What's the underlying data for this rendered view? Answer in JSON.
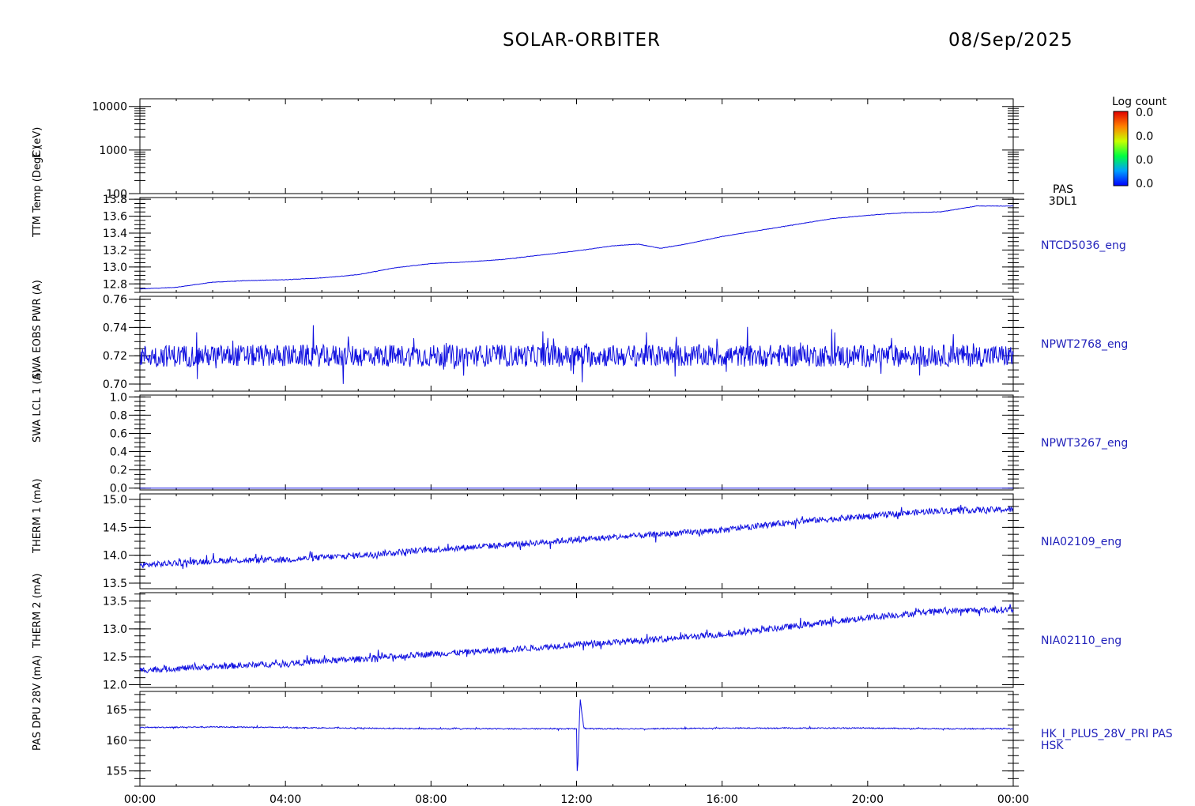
{
  "header": {
    "title": "SOLAR-ORBITER",
    "date": "08/Sep/2025"
  },
  "colors": {
    "trace": "#1010e0",
    "axis": "#000000",
    "label": "#2222bb"
  },
  "colorbar": {
    "title": "Log count",
    "ticks": [
      "0.0",
      "0.0",
      "0.0",
      "0.0"
    ]
  },
  "x_ticks": [
    "00:00",
    "04:00",
    "08:00",
    "12:00",
    "16:00",
    "20:00",
    "00:00"
  ],
  "chart_data": [
    {
      "type": "heatmap",
      "name": "PAS 3DL1",
      "right_label": [
        "PAS",
        "3DL1"
      ],
      "ylabel": "E (eV)",
      "yscale": "log",
      "ylim": [
        100,
        15000
      ],
      "y_ticks": [
        100,
        1000,
        10000
      ],
      "y_tick_labels": [
        "100",
        "1000",
        "10000"
      ],
      "values": []
    },
    {
      "type": "line",
      "name": "NTCD5036_eng",
      "right_label": [
        "NTCD5036_eng"
      ],
      "ylabel": "TTM Temp (DegC)",
      "ylim": [
        12.7,
        13.82
      ],
      "y_ticks": [
        12.8,
        13.0,
        13.2,
        13.4,
        13.6,
        13.8
      ],
      "y_tick_labels": [
        "12.8",
        "13.0",
        "13.2",
        "13.4",
        "13.6",
        "13.8"
      ],
      "noise": 0.004,
      "x": [
        0,
        1,
        2,
        3,
        4,
        5,
        6,
        7,
        8,
        9,
        10,
        11,
        12,
        13,
        13.7,
        14.3,
        15,
        16,
        17,
        18,
        19,
        20,
        21,
        22,
        23,
        24
      ],
      "y": [
        12.74,
        12.76,
        12.82,
        12.84,
        12.85,
        12.87,
        12.91,
        12.99,
        13.04,
        13.06,
        13.09,
        13.14,
        13.19,
        13.25,
        13.27,
        13.22,
        13.27,
        13.36,
        13.43,
        13.5,
        13.57,
        13.61,
        13.64,
        13.65,
        13.72,
        13.72
      ]
    },
    {
      "type": "line",
      "name": "NPWT2768_eng",
      "right_label": [
        "NPWT2768_eng"
      ],
      "ylabel": "SWA EOBS PWR (A)",
      "ylim": [
        0.695,
        0.762
      ],
      "y_ticks": [
        0.7,
        0.72,
        0.74,
        0.76
      ],
      "y_tick_labels": [
        "0.70",
        "0.72",
        "0.74",
        "0.76"
      ],
      "noise": 0.013,
      "x": [
        0,
        12,
        24
      ],
      "y": [
        0.72,
        0.72,
        0.72
      ]
    },
    {
      "type": "line",
      "name": "NPWT3267_eng",
      "right_label": [
        "NPWT3267_eng"
      ],
      "ylabel": "SWA LCL 1 (A)",
      "ylim": [
        -0.02,
        1.02
      ],
      "y_ticks": [
        0.0,
        0.2,
        0.4,
        0.6,
        0.8,
        1.0
      ],
      "y_tick_labels": [
        "0.0",
        "0.2",
        "0.4",
        "0.6",
        "0.8",
        "1.0"
      ],
      "noise": 0.0,
      "x": [
        0,
        24
      ],
      "y": [
        0.0,
        0.0
      ]
    },
    {
      "type": "line",
      "name": "NIA02109_eng",
      "right_label": [
        "NIA02109_eng"
      ],
      "ylabel": "THERM 1 (mA)",
      "ylim": [
        13.4,
        15.1
      ],
      "y_ticks": [
        13.5,
        14.0,
        14.5,
        15.0
      ],
      "y_tick_labels": [
        "13.5",
        "14.0",
        "14.5",
        "15.0"
      ],
      "noise": 0.09,
      "x": [
        0,
        2,
        4,
        6,
        8,
        10,
        12,
        14,
        16,
        18,
        20,
        22,
        24
      ],
      "y": [
        13.82,
        13.9,
        13.92,
        14.0,
        14.1,
        14.18,
        14.28,
        14.36,
        14.45,
        14.6,
        14.7,
        14.8,
        14.82
      ]
    },
    {
      "type": "line",
      "name": "NIA02110_eng",
      "right_label": [
        "NIA02110_eng"
      ],
      "ylabel": "THERM 2 (mA)",
      "ylim": [
        11.95,
        13.65
      ],
      "y_ticks": [
        12.0,
        12.5,
        13.0,
        13.5
      ],
      "y_tick_labels": [
        "12.0",
        "12.5",
        "13.0",
        "13.5"
      ],
      "noise": 0.09,
      "x": [
        0,
        2,
        4,
        6,
        8,
        10,
        12,
        14,
        16,
        18,
        20,
        22,
        24
      ],
      "y": [
        12.26,
        12.32,
        12.38,
        12.46,
        12.55,
        12.62,
        12.72,
        12.8,
        12.9,
        13.05,
        13.2,
        13.32,
        13.35
      ]
    },
    {
      "type": "line",
      "name": "HK_I_PLUS_28V_PRI PAS HSK",
      "right_label": [
        "HK_I_PLUS_28V_PRI PAS",
        "HSK"
      ],
      "ylabel": "PAS DPU 28V (mA)",
      "ylim": [
        152.5,
        168
      ],
      "y_ticks": [
        155,
        160,
        165
      ],
      "y_tick_labels": [
        "155",
        "160",
        "165"
      ],
      "noise": 0.15,
      "x": [
        0,
        2,
        4,
        6,
        8,
        10,
        12,
        12.02,
        12.1,
        12.2,
        12.3,
        14,
        16,
        18,
        20,
        22,
        24
      ],
      "y": [
        162.1,
        162.2,
        162.1,
        162.0,
        161.9,
        161.9,
        161.9,
        153.8,
        166.8,
        162.0,
        161.9,
        161.9,
        162.0,
        162.0,
        162.0,
        161.9,
        161.9
      ]
    }
  ],
  "ylabels_left": [
    "E (eV)",
    "TTM Temp (DegC)",
    "SWA EOBS PWR (A)",
    "SWA LCL 1 (A)",
    "THERM 1 (mA)",
    "THERM 2 (mA)",
    "PAS DPU 28V (mA)"
  ]
}
